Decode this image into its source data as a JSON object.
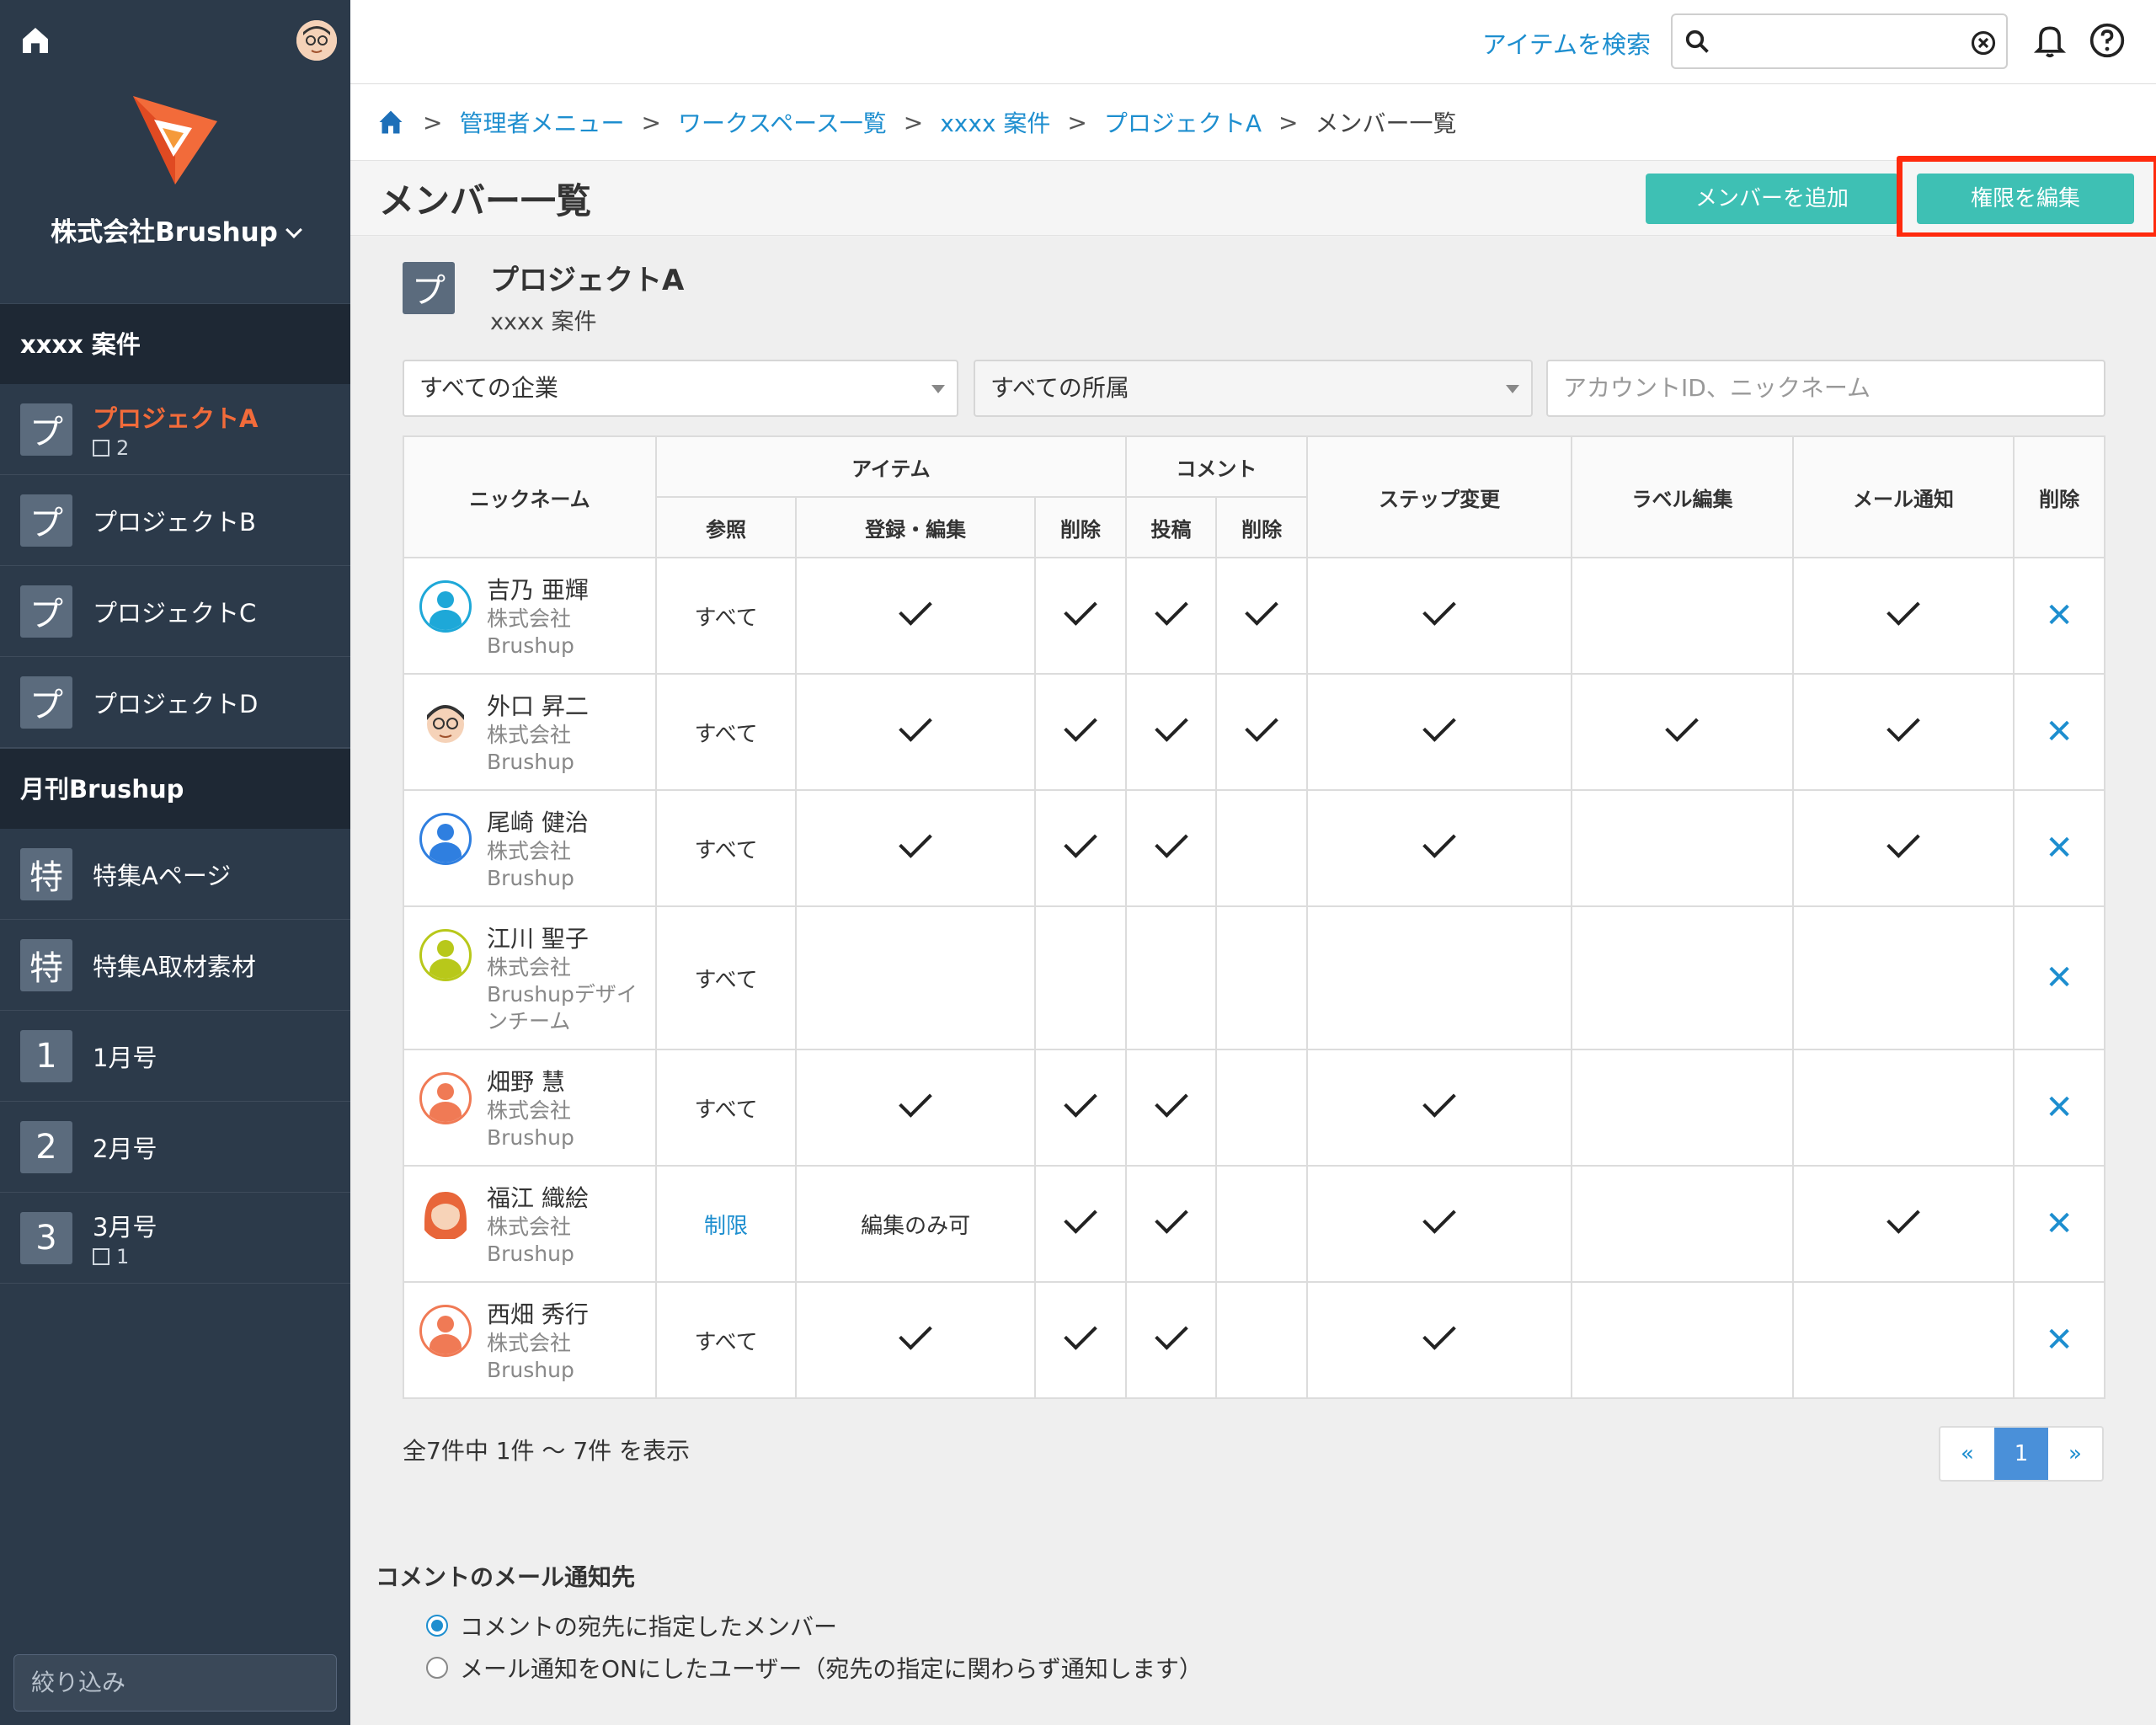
{
  "sidebar": {
    "org_name": "株式会社Brushup",
    "filter_placeholder": "絞り込み",
    "sections": [
      {
        "title": "xxxx 案件",
        "items": [
          {
            "badge": "プ",
            "label": "プロジェクトA",
            "sub": "2",
            "active": true
          },
          {
            "badge": "プ",
            "label": "プロジェクトB"
          },
          {
            "badge": "プ",
            "label": "プロジェクトC"
          },
          {
            "badge": "プ",
            "label": "プロジェクトD"
          }
        ]
      },
      {
        "title": "月刊Brushup",
        "items": [
          {
            "badge": "特",
            "label": "特集Aページ"
          },
          {
            "badge": "特",
            "label": "特集A取材素材"
          },
          {
            "badge": "1",
            "label": "1月号"
          },
          {
            "badge": "2",
            "label": "2月号"
          },
          {
            "badge": "3",
            "label": "3月号",
            "sub": "1"
          }
        ]
      }
    ]
  },
  "topbar": {
    "search_link": "アイテムを検索"
  },
  "breadcrumb": [
    "管理者メニュー",
    "ワークスペース一覧",
    "xxxx 案件",
    "プロジェクトA",
    "メンバー一覧"
  ],
  "title": "メンバー一覧",
  "buttons": {
    "add_member": "メンバーを追加",
    "edit_permissions": "権限を編集"
  },
  "project": {
    "badge": "プ",
    "name": "プロジェクトA",
    "workspace": "xxxx 案件"
  },
  "filters": {
    "company": "すべての企業",
    "department": "すべての所属",
    "search_placeholder": "アカウントID、ニックネーム"
  },
  "table": {
    "headers": {
      "nickname": "ニックネーム",
      "item": "アイテム",
      "comment": "コメント",
      "step": "ステップ変更",
      "label": "ラベル編集",
      "mail": "メール通知",
      "delete": "削除",
      "item_view": "参照",
      "item_edit": "登録・編集",
      "item_delete": "削除",
      "comment_post": "投稿",
      "comment_delete": "削除"
    },
    "rows": [
      {
        "name": "吉乃 亜輝",
        "org": "株式会社\nBrushup",
        "avatar": "#1ea8d8",
        "view": "すべて",
        "edit": true,
        "idel": true,
        "post": true,
        "cdel": true,
        "step": true,
        "label": false,
        "mail": true
      },
      {
        "name": "外口 昇二",
        "org": "株式会社\nBrushup",
        "avatar": "photo",
        "view": "すべて",
        "edit": true,
        "idel": true,
        "post": true,
        "cdel": true,
        "step": true,
        "label": true,
        "mail": true
      },
      {
        "name": "尾崎 健治",
        "org": "株式会社\nBrushup",
        "avatar": "#2f7fe0",
        "view": "すべて",
        "edit": true,
        "idel": true,
        "post": true,
        "cdel": false,
        "step": true,
        "label": false,
        "mail": true
      },
      {
        "name": "江川 聖子",
        "org": "株式会社\nBrushupデザイ\nンチーム",
        "avatar": "#b8c81a",
        "view": "すべて",
        "edit": false,
        "idel": false,
        "post": false,
        "cdel": false,
        "step": false,
        "label": false,
        "mail": false
      },
      {
        "name": "畑野 慧",
        "org": "株式会社\nBrushup",
        "avatar": "#f07a55",
        "view": "すべて",
        "edit": true,
        "idel": true,
        "post": true,
        "cdel": false,
        "step": true,
        "label": false,
        "mail": false
      },
      {
        "name": "福江 織絵",
        "org": "株式会社\nBrushup",
        "avatar": "photo2",
        "view": "制限",
        "edit": "編集のみ可",
        "idel": true,
        "post": true,
        "cdel": false,
        "step": true,
        "label": false,
        "mail": true
      },
      {
        "name": "西畑 秀行",
        "org": "株式会社\nBrushup",
        "avatar": "#f07a55",
        "view": "すべて",
        "edit": true,
        "idel": true,
        "post": true,
        "cdel": false,
        "step": true,
        "label": false,
        "mail": false
      }
    ]
  },
  "count_text": "全7件中 1件 〜 7件 を表示",
  "pagination": {
    "prev": "«",
    "current": "1",
    "next": "»"
  },
  "notification": {
    "title": "コメントのメール通知先",
    "options": [
      {
        "label": "コメントの宛先に指定したメンバー",
        "selected": true
      },
      {
        "label": "メール通知をONにしたユーザー（宛先の指定に関わらず通知します）",
        "selected": false
      }
    ]
  }
}
